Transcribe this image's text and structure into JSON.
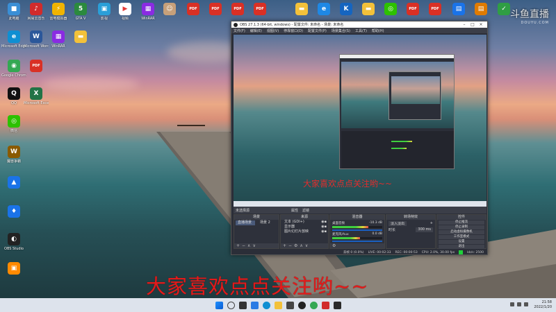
{
  "desktop": {
    "icons": [
      {
        "label": "此电脑",
        "icon": "computer-icon",
        "color": "#3a8fd6",
        "glyph": "■"
      },
      {
        "label": "网易云音乐",
        "icon": "netease-music-icon",
        "color": "#d12b2b",
        "glyph": "♪"
      },
      {
        "label": "雷电模拟器",
        "icon": "ldplayer-icon",
        "color": "#f0b400",
        "glyph": "⚡"
      },
      {
        "label": "GTA V",
        "icon": "gta-icon",
        "color": "#2b8a3e",
        "glyph": "5"
      },
      {
        "label": "影视",
        "icon": "video-icon",
        "color": "#2a9fd8",
        "glyph": "▣"
      },
      {
        "label": "视频",
        "icon": "play-icon",
        "color": "#ffffff",
        "glyph": "▶"
      },
      {
        "label": "WinRAR",
        "icon": "winrar-icon",
        "color": "#8a2be2",
        "glyph": "▦"
      },
      {
        "label": "",
        "icon": "photo-icon",
        "color": "#c7a07a",
        "glyph": "☺"
      },
      {
        "label": "",
        "icon": "pdf-icon",
        "color": "#d93025",
        "glyph": "PDF"
      },
      {
        "label": "",
        "icon": "pdf-icon",
        "color": "#d93025",
        "glyph": "PDF"
      },
      {
        "label": "",
        "icon": "pdf-icon",
        "color": "#d93025",
        "glyph": "PDF"
      },
      {
        "label": "",
        "icon": "pdf-icon",
        "color": "#d93025",
        "glyph": "PDF"
      },
      {
        "label": "",
        "icon": "folder-icon",
        "color": "#f3c13a",
        "glyph": "▬"
      },
      {
        "label": "",
        "icon": "ie-icon",
        "color": "#1e88e5",
        "glyph": "e"
      },
      {
        "label": "",
        "icon": "k-icon",
        "color": "#1565c0",
        "glyph": "K"
      },
      {
        "label": "",
        "icon": "folder-icon",
        "color": "#f3c13a",
        "glyph": "▬"
      },
      {
        "label": "",
        "icon": "wechat-icon",
        "color": "#2dc100",
        "glyph": "◎"
      },
      {
        "label": "",
        "icon": "pdf-icon",
        "color": "#d93025",
        "glyph": "PDF"
      },
      {
        "label": "",
        "icon": "pdf-icon",
        "color": "#d93025",
        "glyph": "PDF"
      },
      {
        "label": "",
        "icon": "app-icon",
        "color": "#1a73e8",
        "glyph": "▤"
      },
      {
        "label": "",
        "icon": "app-icon",
        "color": "#e07b00",
        "glyph": "▤"
      },
      {
        "label": "",
        "icon": "app-icon",
        "color": "#2f9e44",
        "glyph": "✓"
      },
      {
        "label": "Microsoft Edge",
        "icon": "edge-icon",
        "color": "#0f8fd2",
        "glyph": "e"
      },
      {
        "label": "Microsoft Word",
        "icon": "word-icon",
        "color": "#2b579a",
        "glyph": "W"
      },
      {
        "label": "WinRAR",
        "icon": "winrar-icon",
        "color": "#8a2be2",
        "glyph": "▦"
      },
      {
        "label": "",
        "icon": "folder-icon",
        "color": "#f3c13a",
        "glyph": "▬"
      },
      {
        "label": "Google Chrome",
        "icon": "chrome-icon",
        "color": "#34a853",
        "glyph": "◉"
      },
      {
        "label": "",
        "icon": "pdf-icon",
        "color": "#d93025",
        "glyph": "PDF"
      },
      {
        "label": "QQ",
        "icon": "qq-icon",
        "color": "#111111",
        "glyph": "Q"
      },
      {
        "label": "Microsoft Excel",
        "icon": "excel-icon",
        "color": "#217346",
        "glyph": "X"
      },
      {
        "label": "微信",
        "icon": "wechat-icon",
        "color": "#2dc100",
        "glyph": "◎"
      },
      {
        "label": "魔兽争霸",
        "icon": "warcraft-icon",
        "color": "#8a5a00",
        "glyph": "W"
      },
      {
        "label": "",
        "icon": "app-icon",
        "color": "#1a73e8",
        "glyph": "▲"
      },
      {
        "label": "",
        "icon": "app-icon",
        "color": "#1a73e8",
        "glyph": "♦"
      },
      {
        "label": "OBS Studio",
        "icon": "obs-icon",
        "color": "#222222",
        "glyph": "◐"
      },
      {
        "label": "",
        "icon": "app-icon",
        "color": "#ff8a00",
        "glyph": "▣"
      }
    ]
  },
  "watermark": {
    "text": "斗鱼直播",
    "sub": "DOUYU.COM"
  },
  "obs": {
    "title": "OBS 27.1.3 (64-bit, windows) - 配置文件: 未命名 - 场景: 未命名",
    "menu": [
      "文件(F)",
      "编辑(E)",
      "视图(V)",
      "停靠窗口(D)",
      "配置文件(P)",
      "场景集合(S)",
      "工具(T)",
      "帮助(H)"
    ],
    "preview_caption": "大家喜欢点点关注哟~~",
    "toolbar": {
      "scene_label": "未选择源",
      "props": "属性",
      "filters": "滤镜"
    },
    "docks": {
      "scenes": {
        "title": "场景",
        "items": [
          "直播场景",
          "场景 2"
        ]
      },
      "sources": {
        "title": "来源",
        "items": [
          "文本 (GDI+)",
          "显示器",
          "图片幻灯片放映"
        ]
      },
      "mixer": {
        "title": "混音器",
        "channels": [
          {
            "name": "桌面音频",
            "db": "-10.3 dB",
            "level": 0.72
          },
          {
            "name": "麦克风/Aux",
            "db": "0.0 dB",
            "level": 0.55
          }
        ]
      },
      "transitions": {
        "title": "转场特效",
        "fade": "淡入淡出",
        "duration_label": "时长",
        "duration": "300 ms"
      },
      "controls": {
        "title": "控件",
        "buttons": [
          "停止推流",
          "停止录制",
          "启动虚拟摄像机",
          "工作室模式",
          "设置",
          "退出"
        ]
      }
    },
    "status": [
      "丢帧 0 (0.0%)",
      "LIVE: 00:02:33",
      "REC: 00:00:53",
      "CPU: 2.0%, 30.00 fps",
      "kb/s: 2500"
    ]
  },
  "caption": "大家喜欢点点关注哟~~",
  "tray": {
    "time": "21:58",
    "date": "2022/1/20"
  }
}
